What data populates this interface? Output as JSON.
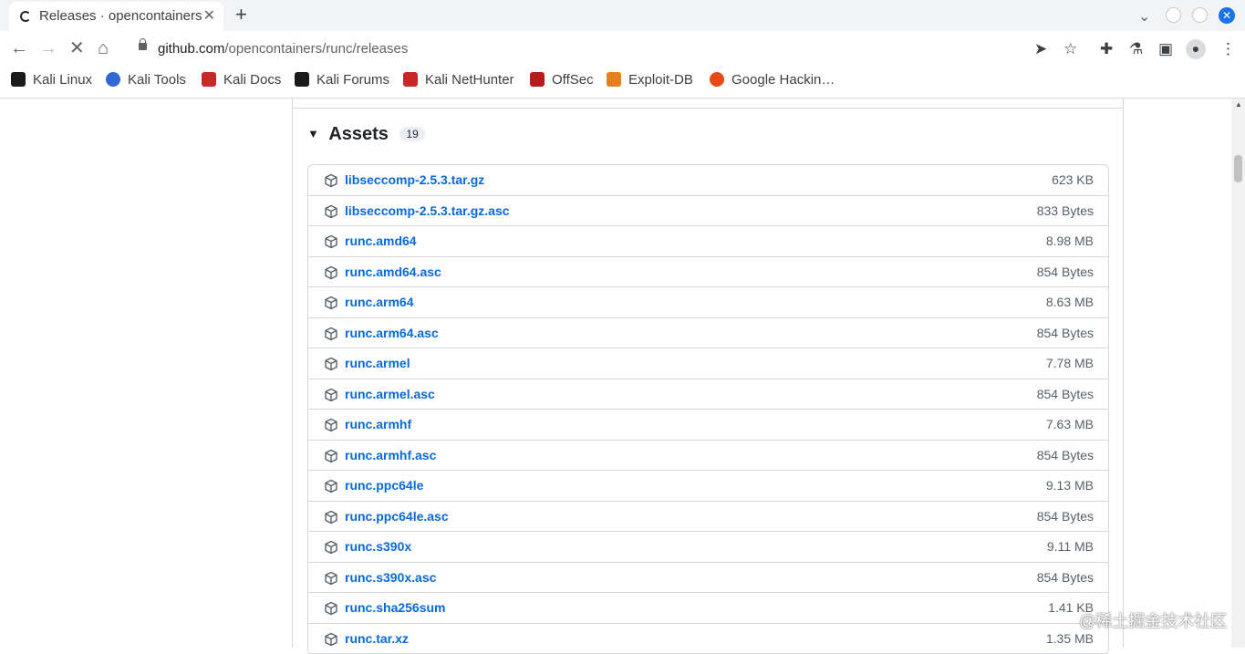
{
  "browser": {
    "tab_title": "Releases · opencontainers/runc",
    "tab_close": "✕",
    "new_tab": "+",
    "url_domain": "github.com",
    "url_path": "/opencontainers/runc/releases"
  },
  "bookmarks": [
    {
      "label": "Kali Linux",
      "color": "#1a1a1a"
    },
    {
      "label": "Kali Tools",
      "color": "#3367d6"
    },
    {
      "label": "Kali Docs",
      "color": "#c62828"
    },
    {
      "label": "Kali Forums",
      "color": "#1a1a1a"
    },
    {
      "label": "Kali NetHunter",
      "color": "#c62828"
    },
    {
      "label": "OffSec",
      "color": "#b71c1c"
    },
    {
      "label": "Exploit-DB",
      "color": "#e67e22"
    },
    {
      "label": "Google Hackin…",
      "color": "#e64a19"
    }
  ],
  "assets": {
    "title": "Assets",
    "count": "19",
    "items": [
      {
        "name": "libseccomp-2.5.3.tar.gz",
        "size": "623 KB"
      },
      {
        "name": "libseccomp-2.5.3.tar.gz.asc",
        "size": "833 Bytes"
      },
      {
        "name": "runc.amd64",
        "size": "8.98 MB"
      },
      {
        "name": "runc.amd64.asc",
        "size": "854 Bytes"
      },
      {
        "name": "runc.arm64",
        "size": "8.63 MB"
      },
      {
        "name": "runc.arm64.asc",
        "size": "854 Bytes"
      },
      {
        "name": "runc.armel",
        "size": "7.78 MB"
      },
      {
        "name": "runc.armel.asc",
        "size": "854 Bytes"
      },
      {
        "name": "runc.armhf",
        "size": "7.63 MB"
      },
      {
        "name": "runc.armhf.asc",
        "size": "854 Bytes"
      },
      {
        "name": "runc.ppc64le",
        "size": "9.13 MB"
      },
      {
        "name": "runc.ppc64le.asc",
        "size": "854 Bytes"
      },
      {
        "name": "runc.s390x",
        "size": "9.11 MB"
      },
      {
        "name": "runc.s390x.asc",
        "size": "854 Bytes"
      },
      {
        "name": "runc.sha256sum",
        "size": "1.41 KB"
      },
      {
        "name": "runc.tar.xz",
        "size": "1.35 MB"
      }
    ]
  },
  "watermark": "@稀土掘金技术社区"
}
